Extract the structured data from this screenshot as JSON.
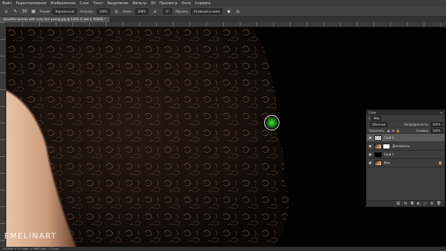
{
  "menu": {
    "items": [
      "Файл",
      "Редактирование",
      "Изображение",
      "Слои",
      "Текст",
      "Выделение",
      "Фильтр",
      "3D",
      "Просмотр",
      "Окно",
      "Справка"
    ]
  },
  "options": {
    "mode_label": "Режим:",
    "mode_value": "Нормальный",
    "opacity_label": "Непрозр.:",
    "opacity_value": "100%",
    "flow_label": "Нажм.:",
    "flow_value": "100%",
    "smoothing_value": "0°",
    "sample_label": "Образец:",
    "sample_value": "Активный и ниже",
    "size_value": "30"
  },
  "document": {
    "tab_title": "beautiful woman with curly hair posing.jpg @ 134% (Слой 2, RGB/8) *"
  },
  "status": {
    "text": "133,84%     4733 пикс. x 4960 пикс. (72 ppi)"
  },
  "watermark": {
    "text": "EMELINART"
  },
  "layers_panel": {
    "title": "Слои",
    "filter_label": "Вид",
    "blend_value": "Обычные",
    "opacity_label": "Непрозрачность:",
    "opacity_value": "100%",
    "lock_label": "Закрепить:",
    "fill_label": "Заливка:",
    "fill_value": "100%",
    "layers": [
      {
        "name": "Слой 2",
        "thumb": "checker",
        "selected": true
      },
      {
        "name": "Дом.волосы",
        "thumb": "face-mask",
        "selected": false
      },
      {
        "name": "Слой 1",
        "thumb": "black",
        "selected": false
      },
      {
        "name": "Фон",
        "thumb": "face",
        "selected": false
      }
    ]
  },
  "icons": {
    "tool": "brush-icon",
    "eye": "eye-icon",
    "lock": "lock-icon"
  }
}
